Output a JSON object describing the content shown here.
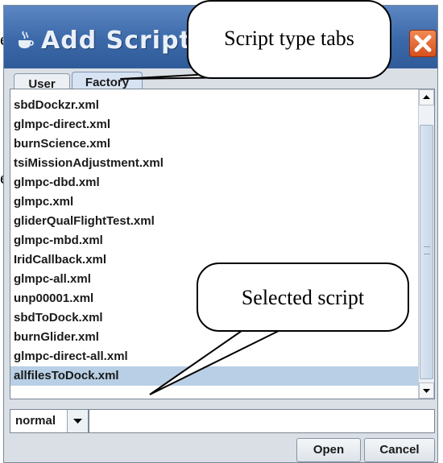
{
  "background": {
    "fragment_top": "e",
    "fragment_mid": "er"
  },
  "window": {
    "title": "Add Script"
  },
  "tabs": [
    {
      "label": "User",
      "active": false
    },
    {
      "label": "Factory",
      "active": true
    }
  ],
  "script_list": {
    "items": [
      "sbdDockzr.xml",
      "glmpc-direct.xml",
      "burnScience.xml",
      "tsiMissionAdjustment.xml",
      "glmpc-dbd.xml",
      "glmpc.xml",
      "gliderQualFlightTest.xml",
      "glmpc-mbd.xml",
      "IridCallback.xml",
      "glmpc-all.xml",
      "unp00001.xml",
      "sbdToDock.xml",
      "burnGlider.xml",
      "glmpc-direct-all.xml",
      "allfilesToDock.xml"
    ],
    "selected": "allfilesToDock.xml"
  },
  "mode_select": {
    "value": "normal"
  },
  "filename_field": {
    "value": ""
  },
  "buttons": {
    "open": "Open",
    "cancel": "Cancel"
  },
  "annotations": {
    "tabs_callout": "Script type tabs",
    "selected_callout": "Selected script"
  },
  "colors": {
    "titlebar": "#3b68a8",
    "selection": "#b8cfe5",
    "close_button": "#e0622b"
  }
}
